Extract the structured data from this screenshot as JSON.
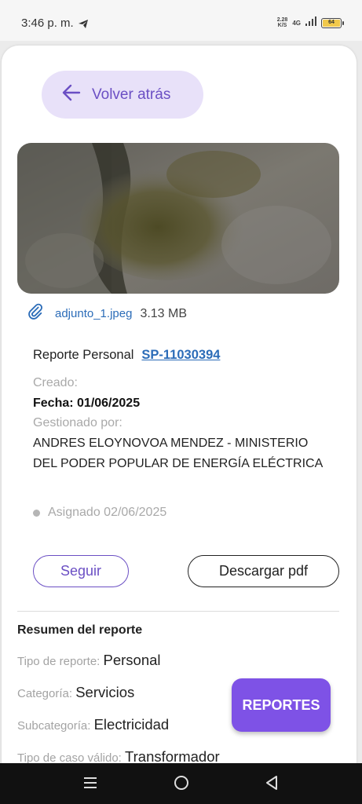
{
  "status_bar": {
    "time": "3:46 p. m.",
    "speed_value": "2.28",
    "speed_unit": "K/S",
    "network": "4G",
    "battery": "64"
  },
  "back_button": {
    "label": "Volver atrás"
  },
  "attachment": {
    "file_name": "adjunto_1.jpeg",
    "file_size": "3.13 MB"
  },
  "report": {
    "label": "Reporte Personal",
    "id": "SP-11030394",
    "created_label": "Creado:",
    "date": "Fecha: 01/06/2025",
    "managed_label": "Gestionado por:",
    "managed_by": "ANDRES ELOYNOVOA MENDEZ - MINISTERIO DEL PODER POPULAR DE ENERGÍA ELÉCTRICA",
    "assigned": "Asignado 02/06/2025"
  },
  "actions": {
    "follow": "Seguir",
    "download_pdf": "Descargar pdf"
  },
  "summary": {
    "title": "Resumen del reporte",
    "rows": [
      {
        "key": "Tipo de reporte:",
        "value": "Personal"
      },
      {
        "key": "Categoría:",
        "value": "Servicios"
      },
      {
        "key": "Subcategoría:",
        "value": "Electricidad"
      },
      {
        "key": "Tipo de caso válido:",
        "value": "Transformador"
      }
    ]
  },
  "fab": {
    "label": "REPORTES"
  },
  "colors": {
    "accent": "#7e52e6",
    "link": "#2b6cb8",
    "pill": "#e8e1f9"
  }
}
